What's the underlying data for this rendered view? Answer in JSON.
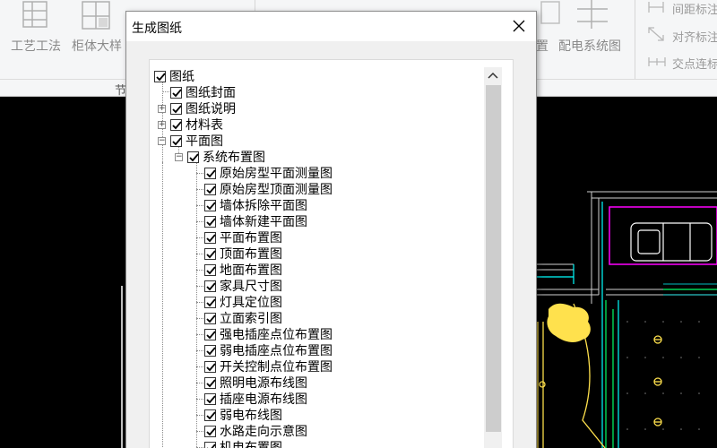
{
  "ribbon": {
    "buttons": [
      {
        "label": "工艺工法",
        "icon": "process-icon"
      },
      {
        "label": "柜体大样",
        "icon": "cabinet-detail-icon"
      },
      {
        "label": "置",
        "icon": "layout-icon"
      },
      {
        "label": "配电系统图",
        "icon": "distribution-system-icon"
      }
    ],
    "small_buttons": [
      {
        "label": "间距标注",
        "icon": "spacing-dim-icon"
      },
      {
        "label": "对齐标注",
        "icon": "align-dim-icon"
      },
      {
        "label": "交点连标",
        "icon": "intersection-dim-icon"
      }
    ],
    "group_label": "节"
  },
  "dialog": {
    "title": "生成图纸",
    "close_icon": "close-icon",
    "tree": {
      "root": {
        "label": "图纸",
        "checked": true,
        "expanded": true
      },
      "level1": [
        {
          "label": "图纸封面",
          "checked": true,
          "expander": "none"
        },
        {
          "label": "图纸说明",
          "checked": true,
          "expander": "plus"
        },
        {
          "label": "材料表",
          "checked": true,
          "expander": "plus"
        },
        {
          "label": "平面图",
          "checked": true,
          "expander": "minus"
        }
      ],
      "system_layout": {
        "label": "系统布置图",
        "checked": true,
        "expander": "minus"
      },
      "items": [
        {
          "label": "原始房型平面测量图",
          "checked": true
        },
        {
          "label": "原始房型顶面测量图",
          "checked": true
        },
        {
          "label": "墙体拆除平面图",
          "checked": true
        },
        {
          "label": "墙体新建平面图",
          "checked": true
        },
        {
          "label": "平面布置图",
          "checked": true
        },
        {
          "label": "顶面布置图",
          "checked": true
        },
        {
          "label": "地面布置图",
          "checked": true
        },
        {
          "label": "家具尺寸图",
          "checked": true
        },
        {
          "label": "灯具定位图",
          "checked": true
        },
        {
          "label": "立面索引图",
          "checked": true
        },
        {
          "label": "强电插座点位布置图",
          "checked": true
        },
        {
          "label": "弱电插座点位布置图",
          "checked": true
        },
        {
          "label": "开关控制点位布置图",
          "checked": true
        },
        {
          "label": "照明电源布线图",
          "checked": true
        },
        {
          "label": "插座电源布线图",
          "checked": true
        },
        {
          "label": "弱电布线图",
          "checked": true
        },
        {
          "label": "水路走向示意图",
          "checked": true
        },
        {
          "label": "机电布置图",
          "checked": true
        }
      ]
    }
  },
  "colors": {
    "cad_background": "#000000",
    "cad_yellow": "#ffe14d",
    "cad_cyan": "#00ffff",
    "cad_magenta": "#ff00ff",
    "cad_green": "#00ff66"
  }
}
